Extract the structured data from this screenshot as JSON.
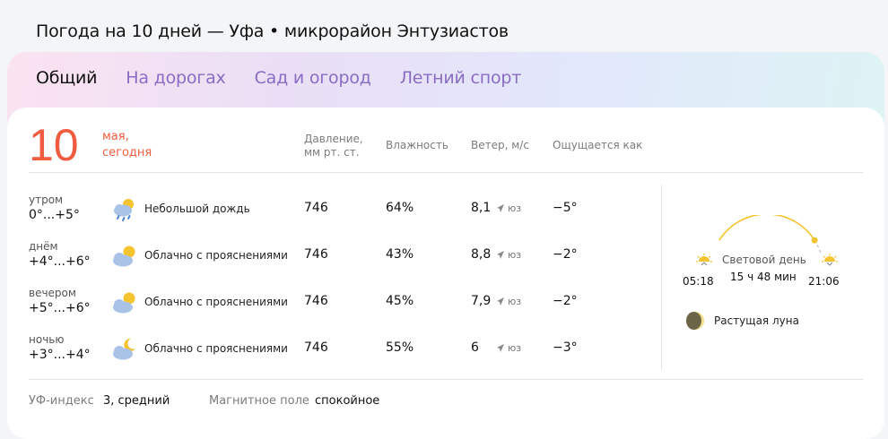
{
  "page_title": "Погода на 10 дней — Уфа • микрорайон Энтузиастов",
  "tabs": [
    {
      "label": "Общий",
      "active": true
    },
    {
      "label": "На дорогах",
      "active": false
    },
    {
      "label": "Сад и огород",
      "active": false
    },
    {
      "label": "Летний спорт",
      "active": false
    }
  ],
  "date": {
    "day": "10",
    "month": "мая,",
    "relative": "сегодня"
  },
  "headers": {
    "pressure_line1": "Давление,",
    "pressure_line2": "мм рт. ст.",
    "humidity": "Влажность",
    "wind": "Ветер, м/с",
    "feels": "Ощущается как"
  },
  "rows": [
    {
      "part": "утром",
      "temp": "0°...+5°",
      "icon": "rain-cloud-sun-icon",
      "condition": "Небольшой дождь",
      "pressure": "746",
      "humidity": "64%",
      "wind_speed": "8,1",
      "wind_dir": "юз",
      "feels": "−5°"
    },
    {
      "part": "днём",
      "temp": "+4°...+6°",
      "icon": "partly-cloudy-icon",
      "condition": "Облачно с прояснениями",
      "pressure": "746",
      "humidity": "43%",
      "wind_speed": "8,8",
      "wind_dir": "юз",
      "feels": "−2°"
    },
    {
      "part": "вечером",
      "temp": "+5°...+6°",
      "icon": "partly-cloudy-icon",
      "condition": "Облачно с прояснениями",
      "pressure": "746",
      "humidity": "45%",
      "wind_speed": "7,9",
      "wind_dir": "юз",
      "feels": "−2°"
    },
    {
      "part": "ночью",
      "temp": "+3°...+4°",
      "icon": "partly-cloudy-night-icon",
      "condition": "Облачно с прояснениями",
      "pressure": "746",
      "humidity": "55%",
      "wind_speed": "6",
      "wind_dir": "юз",
      "feels": "−3°"
    }
  ],
  "sun": {
    "sunrise": "05:18",
    "sunset": "21:06",
    "daylight_label": "Световой день",
    "daylight_value": "15 ч 48 мин",
    "day_progress": 0.82
  },
  "moon": {
    "label": "Растущая луна"
  },
  "footer": {
    "uv_label": "УФ-индекс",
    "uv_value": "3, средний",
    "magnetic_label": "Магнитное поле",
    "magnetic_value": "спокойное"
  },
  "colors": {
    "accent_date": "#ef5c3f",
    "tab_inactive": "#8a6cc4",
    "sun": "#f4c430"
  }
}
